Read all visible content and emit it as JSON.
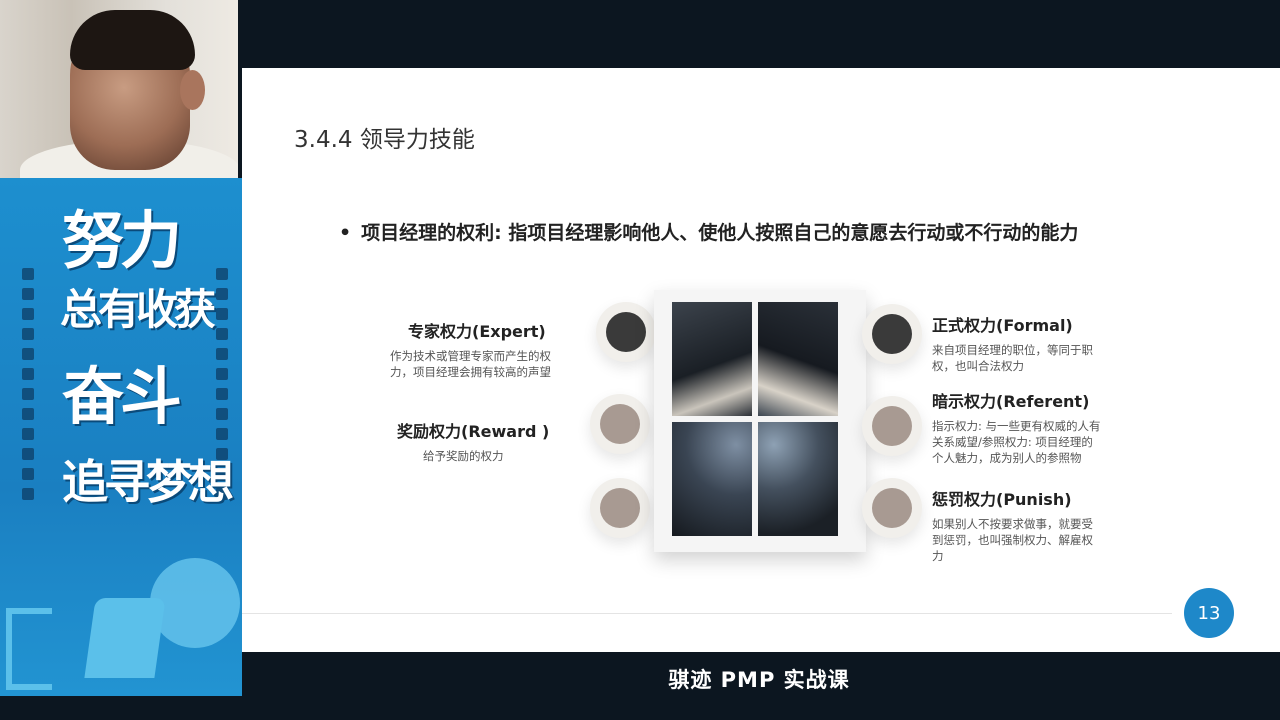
{
  "banner": {
    "line1": "努力",
    "line2": "总有收获",
    "line3": "奋斗",
    "line4": "追寻梦想"
  },
  "slide": {
    "title": "3.4.4 领导力技能",
    "bullet_symbol": "•",
    "bullet_text": "项目经理的权利: 指项目经理影响他人、使他人按照自己的意愿去行动或不行动的能力",
    "powers_left": [
      {
        "title": "专家权力(Expert)",
        "desc": "作为技术或管理专家而产生的权力，项目经理会拥有较高的声望"
      },
      {
        "title": "奖励权力(Reward )",
        "desc": "给予奖励的权力"
      }
    ],
    "powers_right": [
      {
        "title": "正式权力(Formal)",
        "desc": "来自项目经理的职位，等同于职权，也叫合法权力"
      },
      {
        "title": "暗示权力(Referent)",
        "desc": "指示权力: 与一些更有权威的人有关系威望/参照权力: 项目经理的个人魅力，成为别人的参照物"
      },
      {
        "title": "惩罚权力(Punish)",
        "desc": "如果别人不按要求做事，就要受到惩罚，也叫强制权力、解雇权力"
      }
    ],
    "page_number": "13"
  },
  "subtitle": "骐迹 PMP 实战课",
  "colors": {
    "accent_blue": "#1e88c9",
    "banner_blue": "#1d8fcf",
    "dark_dot": "#3a3a3a",
    "taupe_dot": "#a89a92"
  }
}
